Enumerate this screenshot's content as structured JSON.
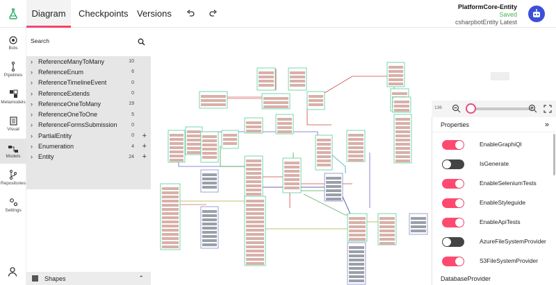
{
  "topbar": {
    "tabs": [
      "Diagram",
      "Checkpoints",
      "Versions"
    ],
    "project_name": "PlatformCore-Entity",
    "status": "Saved",
    "version": "csharpbotEntity Latest"
  },
  "nav": {
    "items": [
      "Bots",
      "Pipelines",
      "Metamodels",
      "Visual",
      "Models",
      "Repositories",
      "Settings"
    ]
  },
  "panel": {
    "search_placeholder": "Search",
    "rows": [
      {
        "label": "ReferenceManyToMany",
        "count": "10"
      },
      {
        "label": "ReferenceEnum",
        "count": "6"
      },
      {
        "label": "ReferenceTimelineEvent",
        "count": "0"
      },
      {
        "label": "ReferenceExtends",
        "count": "0"
      },
      {
        "label": "ReferenceOneToMany",
        "count": "19"
      },
      {
        "label": "ReferenceOneToOne",
        "count": "5"
      },
      {
        "label": "ReferenceFormsSubmission",
        "count": "0"
      },
      {
        "label": "PartialEntity",
        "count": "0",
        "plus": "+"
      },
      {
        "label": "Enumeration",
        "count": "4",
        "plus": "+"
      },
      {
        "label": "Entity",
        "count": "24",
        "plus": "+"
      }
    ],
    "shapes_label": "Shapes"
  },
  "zoom": {
    "level": "136",
    "slider_fraction": 0.0
  },
  "properties": {
    "title": "Properties",
    "collapse": "»",
    "items": [
      {
        "label": "EnableGraphiQl",
        "on": true
      },
      {
        "label": "IsGenerate",
        "on": false
      },
      {
        "label": "EnableSeleniumTests",
        "on": true
      },
      {
        "label": "EnableStyleguide",
        "on": true
      },
      {
        "label": "EnableApiTests",
        "on": true
      },
      {
        "label": "AzureFileSystemProvider",
        "on": false
      },
      {
        "label": "S3FileSystemProvider",
        "on": true
      }
    ],
    "next_section": "DatabaseProvider"
  },
  "colors": {
    "accent": "#ff4970",
    "avatar": "#3b4fd8",
    "saved": "#4caf50"
  }
}
